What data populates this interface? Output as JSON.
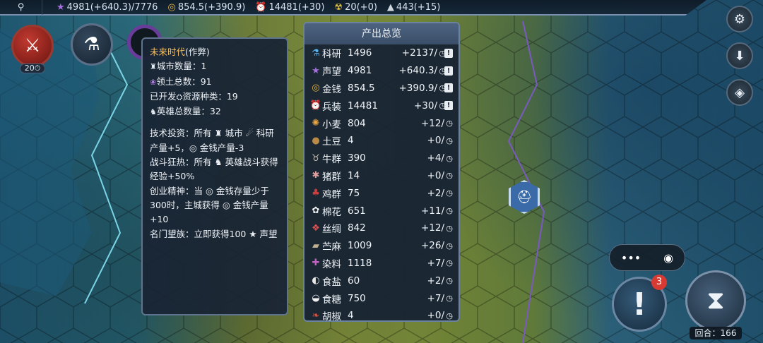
{
  "topbar": {
    "resources": [
      {
        "icon": "star-icon",
        "glyph": "★",
        "text": "4981(+640.3)/7776",
        "color": "#a66ee0"
      },
      {
        "icon": "coin-icon",
        "glyph": "◎",
        "text": "854.5(+390.9)",
        "color": "#e8b23a"
      },
      {
        "icon": "alarm-icon",
        "glyph": "⏰",
        "text": "14481(+30)",
        "color": "#e14848"
      },
      {
        "icon": "radiation-icon",
        "glyph": "☢",
        "text": "20(+0)",
        "color": "#e8c23a"
      },
      {
        "icon": "anvil-icon",
        "glyph": "▲",
        "text": "443(+15)",
        "color": "#cfd6de"
      }
    ]
  },
  "left_buttons": {
    "battle_sub": "20",
    "battle_sub_suffix": "⏱"
  },
  "info_panel": {
    "era": "未来时代",
    "era_tag": "(作弊)",
    "stats": [
      {
        "icon": "city-icon",
        "glyph": "♜",
        "label": "城市数量：",
        "value": "1"
      },
      {
        "icon": "territory-icon",
        "glyph": "❀",
        "label": "领土总数：",
        "value": "91"
      },
      {
        "icon": "",
        "glyph": "",
        "label": "已开发",
        "mid_icon": "⛭",
        "label2": "资源种类：",
        "value": "19"
      },
      {
        "icon": "hero-icon",
        "glyph": "♞",
        "label": "英雄总数量：",
        "value": "32"
      }
    ],
    "effects": [
      "技术投资：所有 ♜ 城市 ☄ 科研产量+5，◎ 金钱产量-3",
      "战斗狂热：所有 ♞ 英雄战斗获得经验+50%",
      "创业精神：当 ◎ 金钱存量少于300时，主城获得 ◎ 金钱产量+10",
      "名门望族：立即获得100 ★ 声望"
    ]
  },
  "summary": {
    "title": "产出总览",
    "rows": [
      {
        "icon": "science-icon",
        "glyph": "⚗",
        "color": "#5ab4f0",
        "name": "科研",
        "value": "1496",
        "rate": "+2137/",
        "warn": true
      },
      {
        "icon": "prestige-icon",
        "glyph": "★",
        "color": "#a66ee0",
        "name": "声望",
        "value": "4981",
        "rate": "+640.3/",
        "warn": true
      },
      {
        "icon": "gold-icon",
        "glyph": "◎",
        "color": "#e8b23a",
        "name": "金钱",
        "value": "854.5",
        "rate": "+390.9/",
        "warn": true
      },
      {
        "icon": "equipment-icon",
        "glyph": "⏰",
        "color": "#e14848",
        "name": "兵装",
        "value": "14481",
        "rate": "+30/",
        "warn": true
      },
      {
        "icon": "wheat-icon",
        "glyph": "✺",
        "color": "#e9a642",
        "name": "小麦",
        "value": "804",
        "rate": "+12/",
        "warn": false
      },
      {
        "icon": "potato-icon",
        "glyph": "●",
        "color": "#b98a45",
        "name": "土豆",
        "value": "4",
        "rate": "+0/",
        "warn": false
      },
      {
        "icon": "cattle-icon",
        "glyph": "♉",
        "color": "#c8c0b0",
        "name": "牛群",
        "value": "390",
        "rate": "+4/",
        "warn": false
      },
      {
        "icon": "pig-icon",
        "glyph": "✱",
        "color": "#e0a0a0",
        "name": "猪群",
        "value": "14",
        "rate": "+0/",
        "warn": false
      },
      {
        "icon": "chicken-icon",
        "glyph": "♣",
        "color": "#d04040",
        "name": "鸡群",
        "value": "75",
        "rate": "+2/",
        "warn": false
      },
      {
        "icon": "cotton-icon",
        "glyph": "✿",
        "color": "#f0f0f0",
        "name": "棉花",
        "value": "651",
        "rate": "+11/",
        "warn": false
      },
      {
        "icon": "silk-icon",
        "glyph": "❖",
        "color": "#e05050",
        "name": "丝绸",
        "value": "842",
        "rate": "+12/",
        "warn": false
      },
      {
        "icon": "hemp-icon",
        "glyph": "▰",
        "color": "#c0b090",
        "name": "苎麻",
        "value": "1009",
        "rate": "+26/",
        "warn": false
      },
      {
        "icon": "dye-icon",
        "glyph": "✚",
        "color": "#c060c0",
        "name": "染料",
        "value": "1118",
        "rate": "+7/",
        "warn": false
      },
      {
        "icon": "salt-icon",
        "glyph": "◐",
        "color": "#e8e8e8",
        "name": "食盐",
        "value": "60",
        "rate": "+2/",
        "warn": false
      },
      {
        "icon": "sugar-icon",
        "glyph": "◒",
        "color": "#f0f0f0",
        "name": "食糖",
        "value": "750",
        "rate": "+7/",
        "warn": false
      },
      {
        "icon": "pepper-icon",
        "glyph": "❧",
        "color": "#d05040",
        "name": "胡椒",
        "value": "4",
        "rate": "+0/",
        "warn": false
      }
    ]
  },
  "controls": {
    "alert_badge": "3",
    "turn_label": "回合：166"
  }
}
